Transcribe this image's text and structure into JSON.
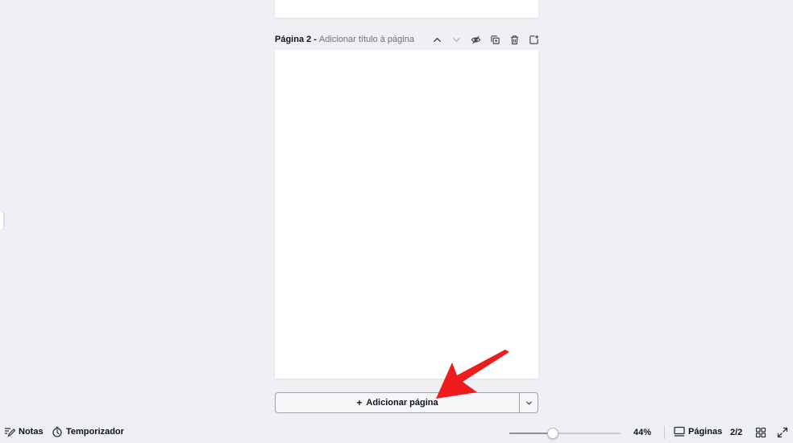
{
  "page_header": {
    "label": "Página 2",
    "separator": "-",
    "title_placeholder": "Adicionar título à página",
    "actions": [
      "chevron-up-icon",
      "chevron-down-icon",
      "hide-page-icon",
      "duplicate-page-icon",
      "delete-page-icon",
      "add-page-icon"
    ]
  },
  "add_page": {
    "plus": "+",
    "label": "Adicionar página"
  },
  "bottom_bar": {
    "notes_label": "Notas",
    "timer_label": "Temporizador",
    "zoom_percent": 44,
    "zoom_label": "44%",
    "pages_label": "Páginas",
    "page_count": "2/2"
  },
  "colors": {
    "background": "#eef0f3",
    "page": "#ffffff",
    "arrow": "#ee1c1c",
    "text": "#0d1216",
    "muted_text": "#6b7176"
  }
}
